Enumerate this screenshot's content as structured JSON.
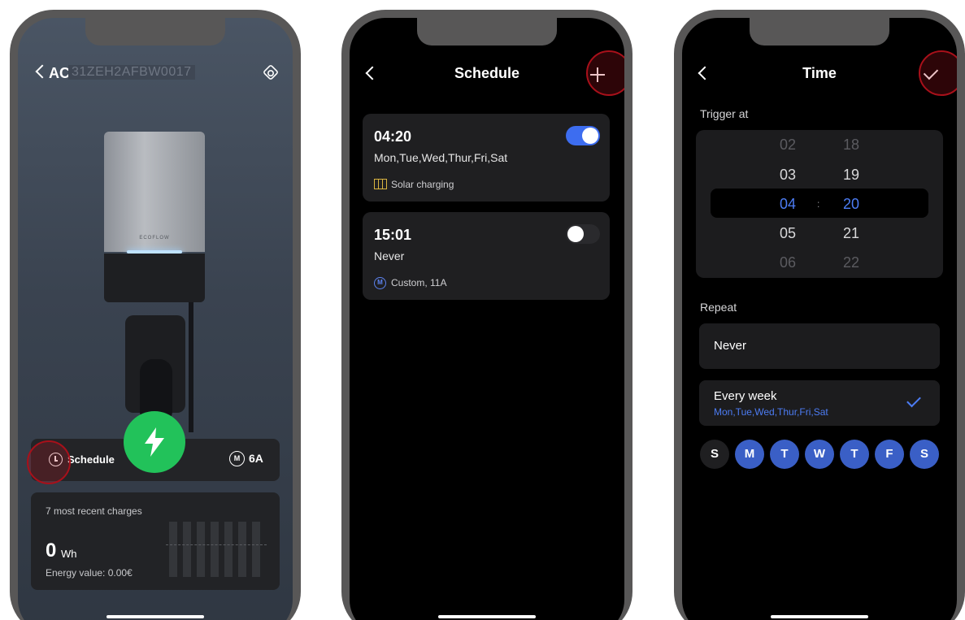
{
  "colors": {
    "accent_blue": "#3d6df0",
    "accent_green": "#22c25a",
    "highlight_red": "#a8101a",
    "solar_yellow": "#d9b441"
  },
  "device": {
    "title": "AC",
    "serial": "31ZEH2AFBW0017",
    "brand_logo": "ECOFLOW",
    "schedule_label": "Schedule",
    "mode_badge": "M",
    "current_amp": "6A",
    "recent": {
      "title": "7 most recent charges",
      "energy_value": "0",
      "energy_unit": "Wh",
      "energy_price": "Energy value: 0.00€"
    }
  },
  "schedule": {
    "title": "Schedule",
    "items": [
      {
        "time": "04:20",
        "days": "Mon,Tue,Wed,Thur,Fri,Sat",
        "mode": "Solar charging",
        "enabled": true,
        "icon": "solar-panel-icon"
      },
      {
        "time": "15:01",
        "days": "Never",
        "mode": "Custom, 11A",
        "enabled": false,
        "icon": "mode-m-icon",
        "mode_badge": "M"
      }
    ]
  },
  "time": {
    "title": "Time",
    "trigger_label": "Trigger at",
    "hours": [
      "02",
      "03",
      "04",
      "05",
      "06"
    ],
    "minutes": [
      "18",
      "19",
      "20",
      "21",
      "22"
    ],
    "selected_hour": "04",
    "selected_minute": "20",
    "colon": ":",
    "repeat_label": "Repeat",
    "options": [
      {
        "title": "Never"
      },
      {
        "title": "Every week",
        "subtitle": "Mon,Tue,Wed,Thur,Fri,Sat",
        "selected": true
      }
    ],
    "days": [
      {
        "label": "S",
        "selected": false
      },
      {
        "label": "M",
        "selected": true
      },
      {
        "label": "T",
        "selected": true
      },
      {
        "label": "W",
        "selected": true
      },
      {
        "label": "T",
        "selected": true
      },
      {
        "label": "F",
        "selected": true
      },
      {
        "label": "S",
        "selected": true
      }
    ]
  }
}
